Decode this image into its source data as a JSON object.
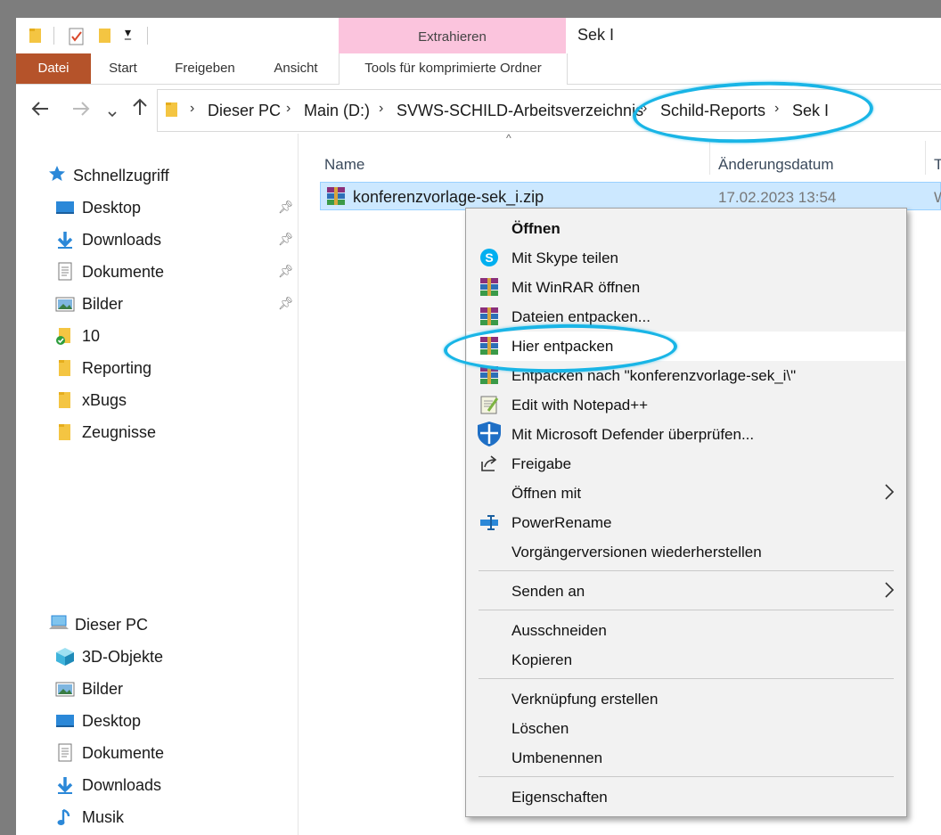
{
  "window": {
    "title": "Sek I"
  },
  "ribbon": {
    "context_group": "Extrahieren",
    "tabs": [
      {
        "label": "Datei"
      },
      {
        "label": "Start"
      },
      {
        "label": "Freigeben"
      },
      {
        "label": "Ansicht"
      },
      {
        "label": "Tools für komprimierte Ordner"
      }
    ]
  },
  "address": {
    "crumbs": [
      "Dieser PC",
      "Main (D:)",
      "SVWS-SCHILD-Arbeitsverzeichnis",
      "Schild-Reports",
      "Sek I"
    ]
  },
  "sidebar": {
    "quick_access": {
      "label": "Schnellzugriff"
    },
    "quick_items": [
      {
        "label": "Desktop",
        "icon": "desktop-icon",
        "pinned": true
      },
      {
        "label": "Downloads",
        "icon": "downloads-icon",
        "pinned": true
      },
      {
        "label": "Dokumente",
        "icon": "documents-icon",
        "pinned": true
      },
      {
        "label": "Bilder",
        "icon": "pictures-icon",
        "pinned": true
      },
      {
        "label": "10",
        "icon": "folder-synced-icon",
        "pinned": false
      },
      {
        "label": "Reporting",
        "icon": "folder-icon",
        "pinned": false
      },
      {
        "label": "xBugs",
        "icon": "folder-icon",
        "pinned": false
      },
      {
        "label": "Zeugnisse",
        "icon": "folder-icon",
        "pinned": false
      }
    ],
    "this_pc": {
      "label": "Dieser PC"
    },
    "pc_items": [
      {
        "label": "3D-Objekte",
        "icon": "3d-objects-icon"
      },
      {
        "label": "Bilder",
        "icon": "pictures-icon"
      },
      {
        "label": "Desktop",
        "icon": "desktop-icon"
      },
      {
        "label": "Dokumente",
        "icon": "documents-icon"
      },
      {
        "label": "Downloads",
        "icon": "downloads-icon"
      },
      {
        "label": "Musik",
        "icon": "music-icon"
      }
    ]
  },
  "filelist": {
    "columns": {
      "name": "Name",
      "date": "Änderungsdatum",
      "type": "T"
    },
    "files": [
      {
        "name": "konferenzvorlage-sek_i.zip",
        "date": "17.02.2023 13:54",
        "type": "W"
      }
    ]
  },
  "context_menu": {
    "items": [
      {
        "label": "Öffnen",
        "bold": true,
        "icon": ""
      },
      {
        "label": "Mit Skype teilen",
        "icon": "skype-icon"
      },
      {
        "label": "Mit WinRAR öffnen",
        "icon": "winrar-icon"
      },
      {
        "label": "Dateien entpacken...",
        "icon": "winrar-icon"
      },
      {
        "label": "Hier entpacken",
        "icon": "winrar-icon",
        "highlighted": true
      },
      {
        "label": "Entpacken nach \"konferenzvorlage-sek_i\\\"",
        "icon": "winrar-icon"
      },
      {
        "label": "Edit with Notepad++",
        "icon": "notepadpp-icon"
      },
      {
        "label": "Mit Microsoft Defender überprüfen...",
        "icon": "defender-icon"
      },
      {
        "label": "Freigabe",
        "icon": "share-icon"
      },
      {
        "label": "Öffnen mit",
        "icon": "",
        "submenu": true
      },
      {
        "label": "PowerRename",
        "icon": "powerrename-icon"
      },
      {
        "label": "Vorgängerversionen wiederherstellen",
        "icon": ""
      },
      {
        "label": "Senden an",
        "icon": "",
        "submenu": true
      },
      {
        "label": "Ausschneiden",
        "icon": ""
      },
      {
        "label": "Kopieren",
        "icon": ""
      },
      {
        "label": "Verknüpfung erstellen",
        "icon": ""
      },
      {
        "label": "Löschen",
        "icon": ""
      },
      {
        "label": "Umbenennen",
        "icon": ""
      },
      {
        "label": "Eigenschaften",
        "icon": ""
      }
    ]
  },
  "colors": {
    "file_tab": "#b5532a",
    "context_group": "#fbc4dd",
    "selection": "#cce8ff",
    "annotation": "#19b5e6"
  }
}
